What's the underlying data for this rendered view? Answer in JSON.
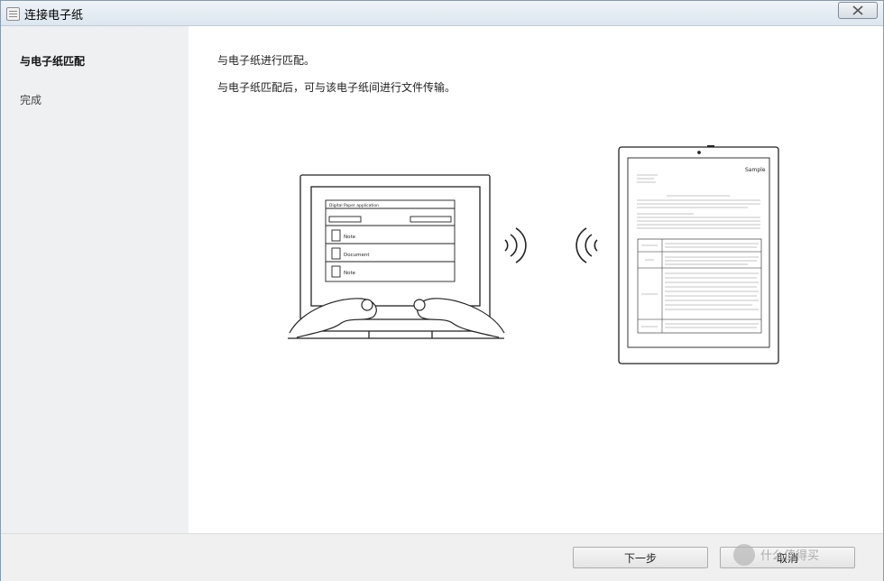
{
  "window": {
    "title": "连接电子纸"
  },
  "sidebar": {
    "steps": [
      {
        "label": "与电子纸匹配"
      },
      {
        "label": "完成"
      }
    ]
  },
  "main": {
    "heading": "与电子纸进行匹配。",
    "description": "与电子纸匹配后，可与该电子纸间进行文件传输。"
  },
  "illustration": {
    "app_title": "Digital Paper application",
    "files": [
      {
        "label": "Note"
      },
      {
        "label": "Document"
      },
      {
        "label": "Note"
      }
    ],
    "paper_label": "Sample"
  },
  "footer": {
    "next_label": "下一步",
    "cancel_label": "取消"
  },
  "watermark": {
    "text": "什么值得买"
  }
}
